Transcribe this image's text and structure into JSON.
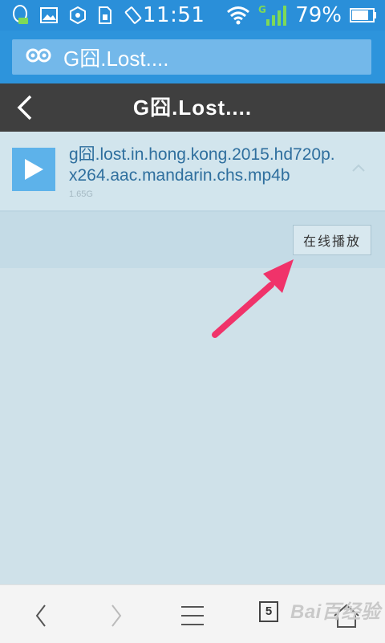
{
  "status_bar": {
    "time": "11:51",
    "battery_percent": "79%",
    "network_type": "G",
    "icons": [
      "qq-icon",
      "image-icon",
      "settings-icon",
      "sim-icon",
      "rotate-icon",
      "wifi-icon",
      "signal-icon",
      "battery-icon"
    ]
  },
  "search": {
    "text": "G囧.Lost....",
    "icon": "mask-icon"
  },
  "title_bar": {
    "title": "G囧.Lost....",
    "back_icon": "back-chevron-icon"
  },
  "file": {
    "name": "g囧.lost.in.hong.kong.2015.hd720p.x264.aac.mandarin.chs.mp4b",
    "size": "1.65G",
    "thumb_icon": "play-icon",
    "expand_icon": "chevron-up-icon"
  },
  "actions": {
    "play_online_label": "在线播放"
  },
  "bottom_nav": {
    "back_icon": "nav-back-icon",
    "forward_icon": "nav-forward-icon",
    "menu_icon": "menu-icon",
    "tabs_count": "5",
    "home_icon": "home-icon"
  },
  "watermark": "Bai百经验",
  "colors": {
    "status_bar": "#2a8fd9",
    "search_bar": "#2d94dc",
    "title_bar": "#3f3f3f",
    "content_bg": "#cfe1e9",
    "file_name": "#2f6f9e",
    "arrow": "#f0336a"
  }
}
